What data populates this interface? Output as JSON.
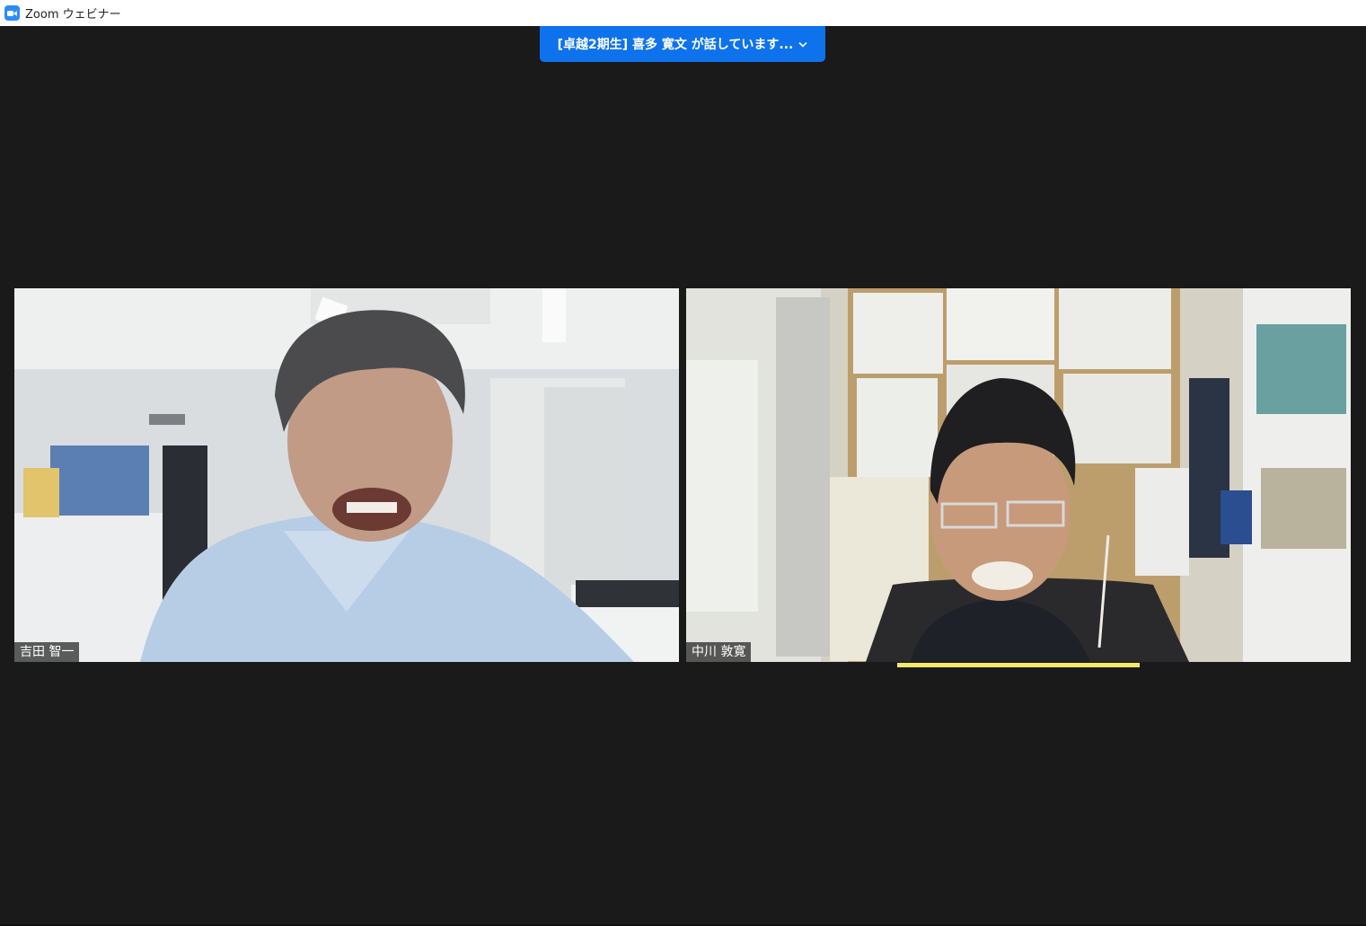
{
  "window": {
    "title": "Zoom ウェビナー",
    "icon": "zoom-camera-icon"
  },
  "banner": {
    "text": "[卓越2期生] 喜多 寛文 が話しています...",
    "icon": "chevron-down-icon",
    "color": "#0e72ed"
  },
  "participants": [
    {
      "name": "吉田 智一",
      "speaking": false
    },
    {
      "name": "中川 敦寛",
      "speaking": true
    }
  ],
  "colors": {
    "background": "#1a1a1a",
    "active_speaker_highlight": "#f5e86a"
  }
}
